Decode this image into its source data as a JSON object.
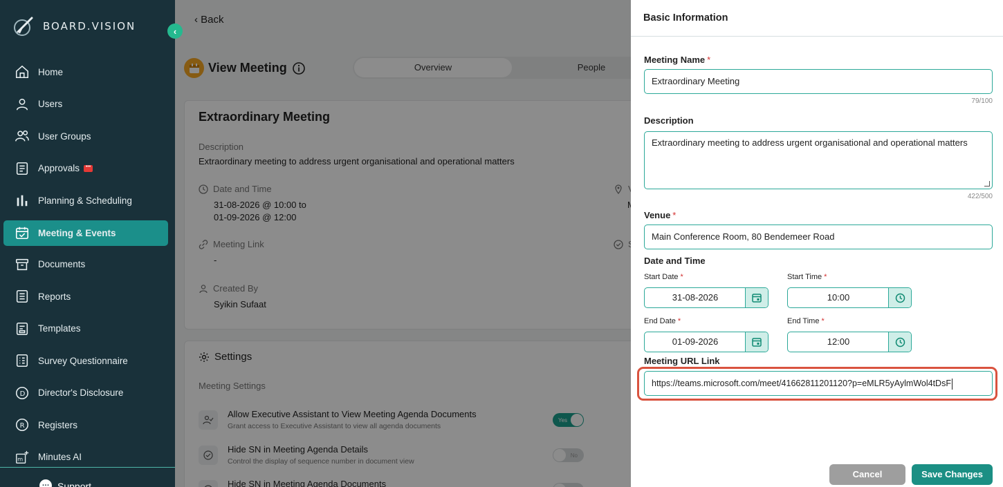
{
  "brand": {
    "name": "BOARD.VISION"
  },
  "sidebar": {
    "items": [
      {
        "label": "Home",
        "icon": "home-icon"
      },
      {
        "label": "Users",
        "icon": "user-icon"
      },
      {
        "label": "User Groups",
        "icon": "users-icon"
      },
      {
        "label": "Approvals",
        "icon": "approvals-icon",
        "badge": "•••"
      },
      {
        "label": "Planning & Scheduling",
        "icon": "bar-chart-icon"
      },
      {
        "label": "Meeting & Events",
        "icon": "calendar-check-icon",
        "active": true
      },
      {
        "label": "Documents",
        "icon": "archive-icon"
      },
      {
        "label": "Reports",
        "icon": "list-icon"
      },
      {
        "label": "Templates",
        "icon": "template-icon"
      },
      {
        "label": "Survey Questionnaire",
        "icon": "survey-icon"
      },
      {
        "label": "Director's Disclosure",
        "icon": "d-circle-icon"
      },
      {
        "label": "Registers",
        "icon": "r-circle-icon"
      },
      {
        "label": "Minutes AI",
        "icon": "minutes-ai-icon"
      }
    ],
    "support": "Support"
  },
  "header": {
    "back": "Back",
    "title": "View Meeting",
    "tabs": [
      "Overview",
      "People"
    ]
  },
  "meeting": {
    "name": "Extraordinary Meeting",
    "description_label": "Description",
    "description": "Extraordinary meeting to address urgent organisational and operational matters",
    "datetime_label": "Date and Time",
    "datetime_start": "31-08-2026 @ 10:00 to",
    "datetime_end": "01-09-2026 @ 12:00",
    "venue_label_partial": "V",
    "venue_value_partial": "M",
    "link_label": "Meeting Link",
    "link_value": "-",
    "status_label_partial": "S",
    "created_label": "Created By",
    "created_value": "Syikin Sufaat"
  },
  "settings": {
    "title": "Settings",
    "subtitle": "Meeting Settings",
    "rows": [
      {
        "title": "Allow Executive Assistant to View Meeting Agenda Documents",
        "desc": "Grant access to Executive Assistant to view all agenda documents",
        "toggle": "Yes"
      },
      {
        "title": "Hide SN in Meeting Agenda Details",
        "desc": "Control the display of sequence number in document view",
        "toggle": "No"
      },
      {
        "title": "Hide SN in Meeting Agenda Documents",
        "desc": "",
        "toggle": "No"
      }
    ]
  },
  "panel": {
    "title": "Basic Information",
    "name_label": "Meeting Name",
    "name_value": "Extraordinary Meeting",
    "name_counter": "79/100",
    "desc_label": "Description",
    "desc_value": "Extraordinary meeting to address urgent organisational and operational matters",
    "desc_counter": "422/500",
    "venue_label": "Venue",
    "venue_value": "Main Conference Room, 80 Bendemeer Road",
    "datetime_label": "Date and Time",
    "start_date_label": "Start Date",
    "start_date": "31-08-2026",
    "start_time_label": "Start Time",
    "start_time": "10:00",
    "end_date_label": "End Date",
    "end_date": "01-09-2026",
    "end_time_label": "End Time",
    "end_time": "12:00",
    "url_label": "Meeting URL Link",
    "url_value": "https://teams.microsoft.com/meet/41662811201120?p=eMLR5yAylmWol4tDsF",
    "required_mark": "*",
    "cancel": "Cancel",
    "save": "Save Changes"
  },
  "colors": {
    "sidebar_bg": "#19313a",
    "accent": "#1b8f8a",
    "highlight": "#d9533f"
  }
}
